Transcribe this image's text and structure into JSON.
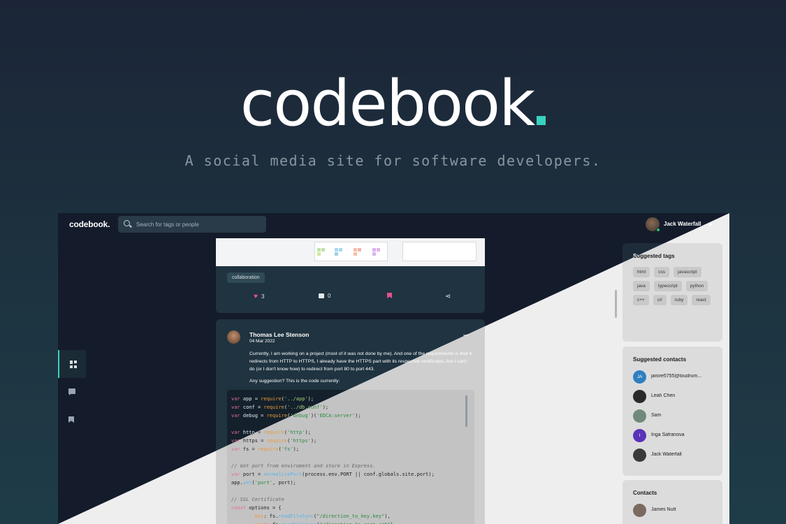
{
  "hero": {
    "title": "codebook",
    "subtitle": "A social media site for software developers."
  },
  "topbar": {
    "brand": "codebook.",
    "search_placeholder": "Search for tags or people",
    "username": "Jack Waterfall"
  },
  "post1": {
    "tag": "collaboration",
    "likes": "3",
    "comments": "0"
  },
  "post2": {
    "author": "Thomas Lee Stenson",
    "date": "04 Mar 2022",
    "text": "Currently, I am working on a project (most of it was not done by me). And one of the requirements is that it redirects from HTTP to HTTPS, I already have the HTTPS part with its respective certificates, but I can't do (or I don't know how) to redirect from port 80 to port 443.",
    "question": "Any suggestion? This is the code currently:"
  },
  "suggested_tags": {
    "title": "Suggested tags",
    "tags": [
      "html",
      "css",
      "javascript",
      "java",
      "typescript",
      "python",
      "c++",
      "c#",
      "ruby",
      "react"
    ]
  },
  "suggested_contacts": {
    "title": "Suggested contacts",
    "items": [
      {
        "name": "jarore5755@toudrum...",
        "initials": "JA",
        "color": "#2e7fc0"
      },
      {
        "name": "Leah Chen",
        "initials": "",
        "color": "#2a2a2a"
      },
      {
        "name": "Sam",
        "initials": "",
        "color": "#6f8a7a"
      },
      {
        "name": "Inga Safranova",
        "initials": "I",
        "color": "#5b33b8"
      },
      {
        "name": "Jack Waterfall",
        "initials": "",
        "color": "#3a3a3a"
      }
    ]
  },
  "contacts": {
    "title": "Contacts",
    "items": [
      {
        "name": "James Nutt",
        "initials": "",
        "color": "#7a6a60"
      }
    ]
  },
  "colors": {
    "accent": "#39d2c0",
    "like": "#e8508a"
  }
}
